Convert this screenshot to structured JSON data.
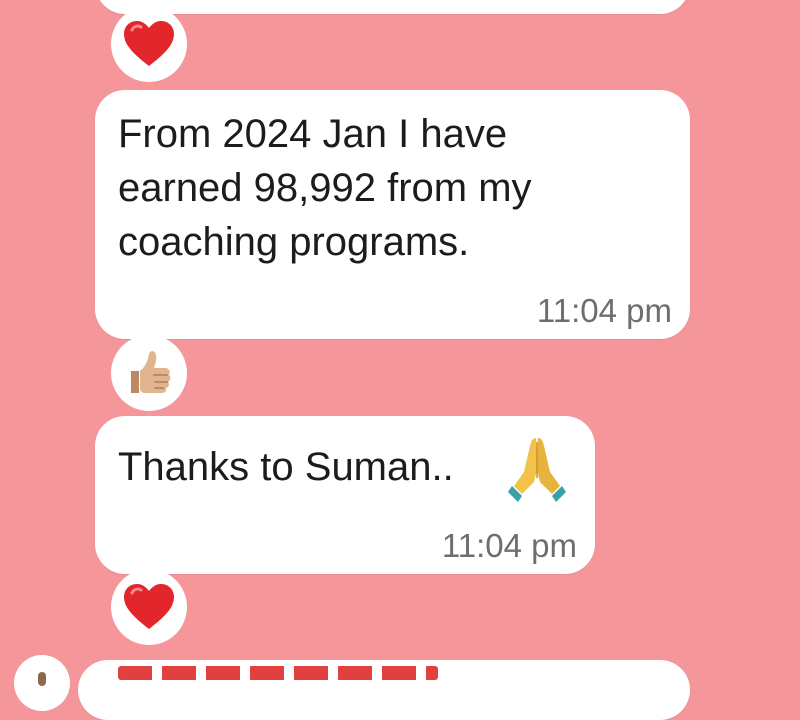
{
  "chat": {
    "messages": [
      {
        "lines": [
          "From 2024 Jan I have",
          "earned 98,992 from my",
          "coaching programs."
        ],
        "time": "11:04 pm",
        "reaction": "thumbs-up-icon"
      },
      {
        "text": "Thanks to Suman..",
        "trailing_emoji": "folded-hands-icon",
        "time": "11:04 pm",
        "reaction": "red-heart-icon"
      }
    ],
    "top_message_reaction": "red-heart-icon"
  },
  "colors": {
    "background": "#f4969a",
    "bubble": "#ffffff",
    "text": "#1c1c1c",
    "time": "#6e6e6e",
    "heart": "#e2262b"
  }
}
